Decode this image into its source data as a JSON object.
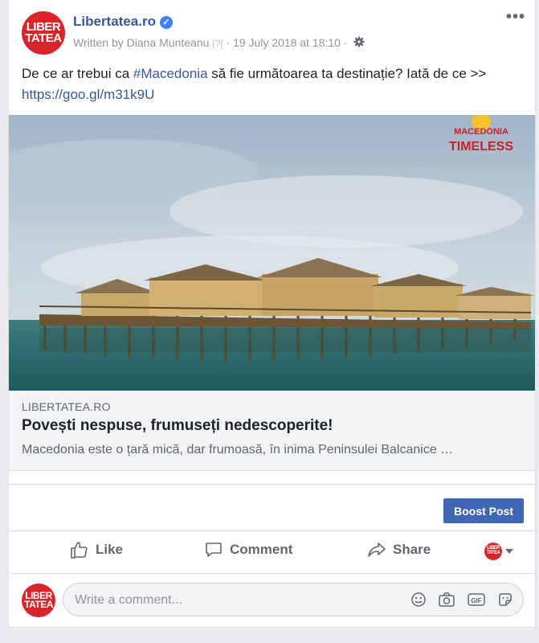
{
  "post": {
    "page_name": "Libertatea.ro",
    "logo_text_line1": "LIBER",
    "logo_text_line2": "TATEA",
    "verified_mark": "✓",
    "author": "Written by Diana Munteanu",
    "help_marker": "[?]",
    "separator": "·",
    "timestamp": "19 July 2018 at 18:10",
    "more_menu": "•••",
    "text_before_tag": "De ce ar trebui ca ",
    "hashtag": "#Macedonia",
    "text_after_tag": " să fie următoarea ta destinație? Iată de ce >> ",
    "link": "https://goo.gl/m31k9U"
  },
  "image": {
    "watermark_line1": "MACEDONIA",
    "watermark_line2": "TIMELESS",
    "icon": "lake-stilt-houses-photo"
  },
  "preview": {
    "domain": "LIBERTATEA.RO",
    "title": "Povești nespuse, frumuseți nedescoperite!",
    "description": "Macedonia este o țară mică, dar frumoasă, în inima Peninsulei Balcanice …"
  },
  "boost": {
    "label": "Boost Post",
    "color": "#4267b2"
  },
  "actions": {
    "like": "Like",
    "comment": "Comment",
    "share": "Share"
  },
  "comment": {
    "placeholder": "Write a comment...",
    "icons": [
      "emoji-icon",
      "camera-icon",
      "gif-icon",
      "sticker-icon"
    ],
    "gif_label": "GIF"
  },
  "colors": {
    "brand_red": "#d9252a",
    "link_blue": "#365899",
    "fb_blue": "#4267b2"
  }
}
